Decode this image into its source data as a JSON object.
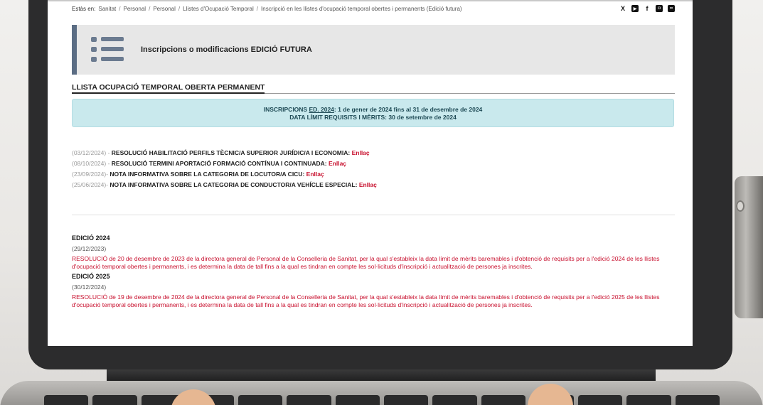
{
  "breadcrumb": {
    "lead": "Estàs en:",
    "items": [
      "Sanitat",
      "Personal",
      "Personal",
      "Llistes d'Ocupació Temporal",
      "Inscripció en les llistes d'ocupació temporal obertes i permanents (Edició futura)"
    ]
  },
  "social": {
    "x": "X",
    "youtube": "▶",
    "facebook": "f",
    "instagram": "◘",
    "flickr": "••"
  },
  "banner": {
    "title": "Inscripcions o modificacions EDICIÓ FUTURA"
  },
  "section": {
    "title": "LLISTA OCUPACIÓ TEMPORAL OBERTA PERMANENT"
  },
  "info": {
    "line1_prefix": "INSCRIPCIONS ",
    "line1_link": "ED. 2024",
    "line1_suffix": ": 1 de gener de 2024 fins al 31 de desembre de 2024",
    "line2": "DATA LÍMIT REQUISITS I MÈRITS: 30 de setembre de 2024"
  },
  "news": [
    {
      "date": "(03/12/2024) - ",
      "title": "RESOLUCIÓ HABILITACIÓ PERFILS TÈCNIC/A SUPERIOR JURÍDIC/A I ECONOMIA",
      "sep": ": ",
      "link": "Enllaç"
    },
    {
      "date": "(08/10/2024) - ",
      "title": "RESOLUCIÓ TERMINI APORTACIÓ FORMACIÓ CONTÍNUA I CONTINUADA:",
      "sep": " ",
      "link": "Enllaç"
    },
    {
      "date": "(23/09/2024)- ",
      "title": "NOTA INFORMATIVA SOBRE LA CATEGORIA DE LOCUTOR/A CICU:",
      "sep": " ",
      "link": "Enllaç"
    },
    {
      "date": "(25/06/2024)- ",
      "title": "NOTA INFORMATIVA SOBRE LA CATEGORIA DE CONDUCTOR/A VEHÍCLE ESPECIAL:",
      "sep": " ",
      "link": "Enllaç"
    }
  ],
  "editions": [
    {
      "heading": "EDICIÓ 2024",
      "date": "(29/12/2023)",
      "text": "RESOLUCIÓ de 20 de desembre de 2023 de la directora general de Personal de la Conselleria de Sanitat, per la qual s'estableix la data límit de mèrits baremables i d'obtenció de requisits per a l'edició 2024 de les llistes d'ocupació temporal obertes i permanents, i es determina la data de tall fins a la qual es tindran en compte les sol·licituds d'inscripció i actualització de persones ja inscrites."
    },
    {
      "heading": "EDICIÓ 2025",
      "date": "(30/12/2024)",
      "text": "RESOLUCIÓ de 19 de desembre de 2024 de la directora general de Personal de la Conselleria de Sanitat, per la qual s'estableix la data límit de mèrits baremables i d'obtenció de requisits per a l'edició 2025 de les llistes d'ocupació temporal obertes i permanents, i es determina la data de tall fins a la qual es tindran en compte les sol·licituds d'inscripció i actualització de persones ja inscrites."
    }
  ],
  "colors": {
    "link_red": "#c8102e",
    "info_bg": "#c9e9ed",
    "banner_accent": "#5b6d84"
  }
}
